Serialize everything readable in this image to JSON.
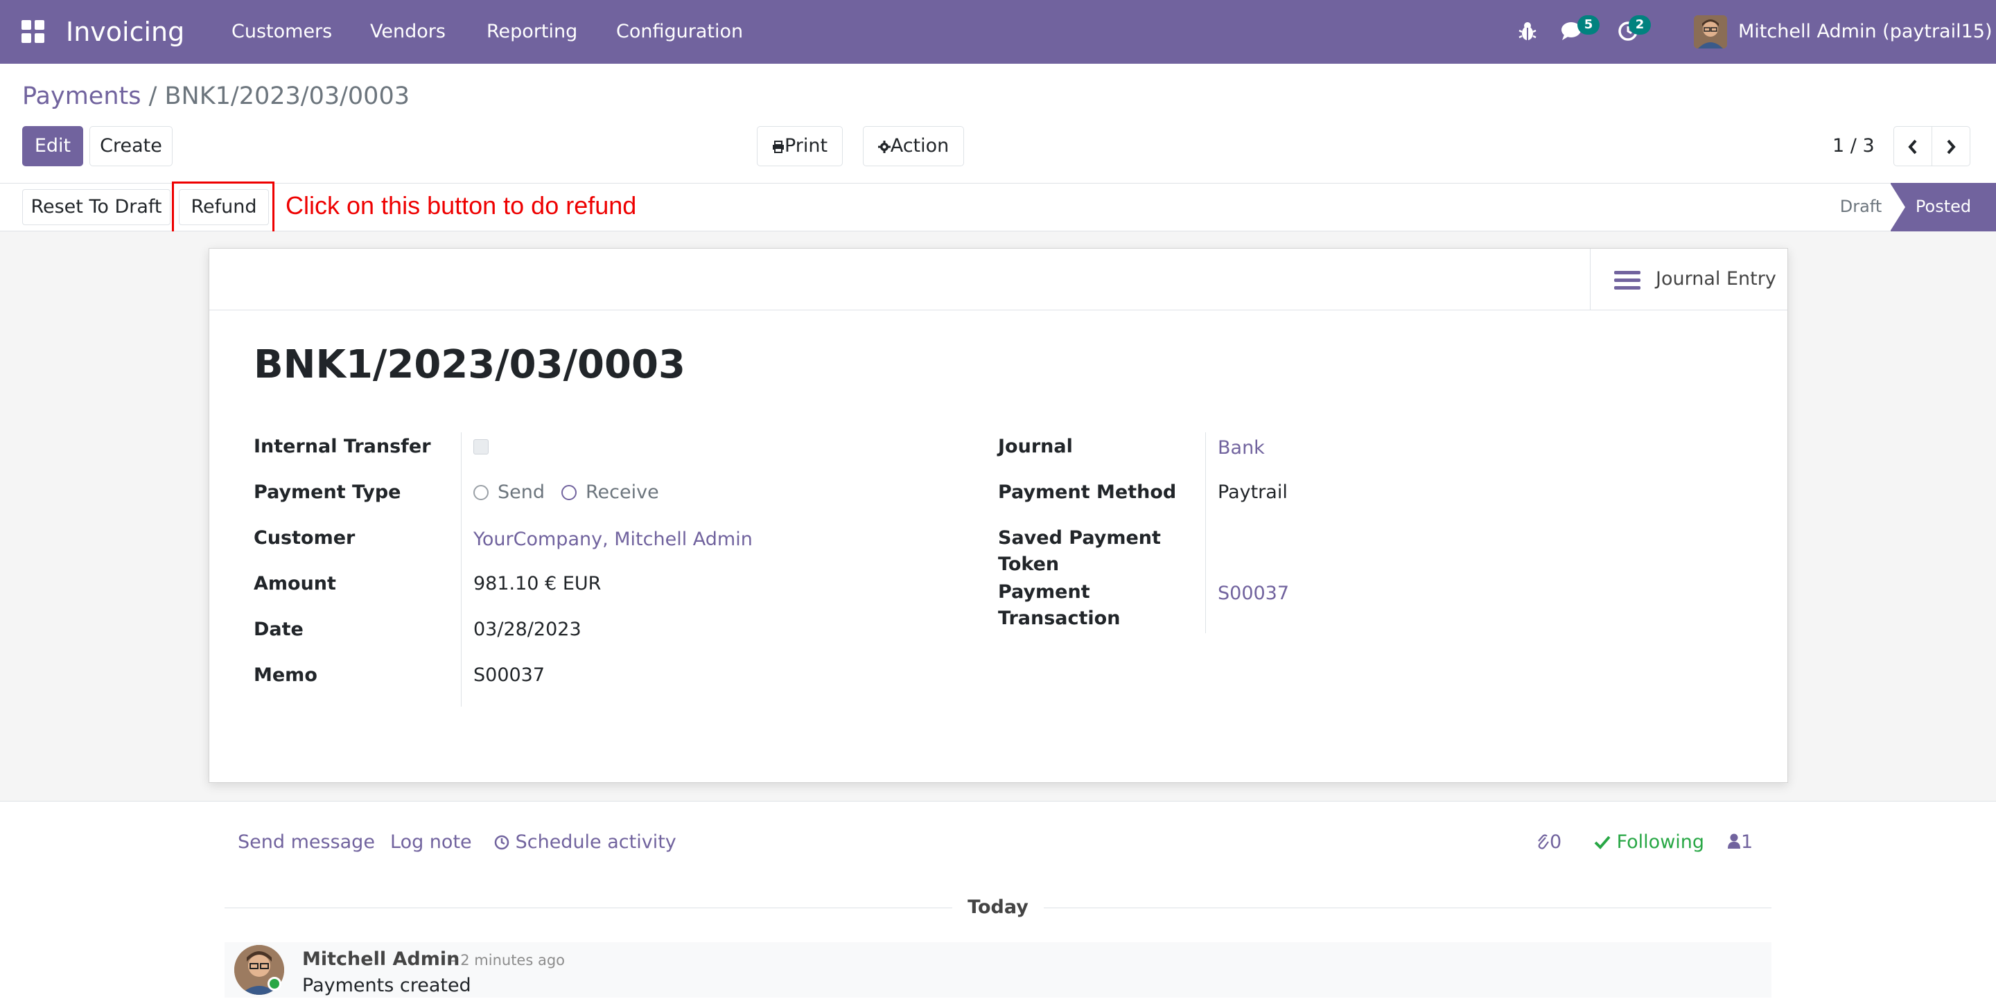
{
  "navbar": {
    "app_title": "Invoicing",
    "menu": [
      "Customers",
      "Vendors",
      "Reporting",
      "Configuration"
    ],
    "messages_badge": "5",
    "activities_badge": "2",
    "user_name": "Mitchell Admin (paytrail15)",
    "icons": [
      "apps-grid-icon",
      "bug-icon",
      "chat-icon",
      "clock-icon"
    ]
  },
  "breadcrumb": {
    "parent": "Payments",
    "separator": " / ",
    "current": "BNK1/2023/03/0003"
  },
  "control": {
    "edit_label": "Edit",
    "create_label": "Create",
    "print_label": "Print",
    "action_label": "Action",
    "pager": "1 / 3"
  },
  "statusbar": {
    "reset_label": "Reset To Draft",
    "refund_label": "Refund",
    "annotation": "Click on this button to do refund",
    "stages": [
      "Draft",
      "Posted"
    ],
    "active_stage": "Posted"
  },
  "form": {
    "smart_button": "Journal Entry",
    "title": "BNK1/2023/03/0003",
    "left": {
      "internal_transfer_label": "Internal Transfer",
      "internal_transfer_checked": false,
      "payment_type_label": "Payment Type",
      "payment_type_options": [
        "Send",
        "Receive"
      ],
      "customer_label": "Customer",
      "customer_value": "YourCompany, Mitchell Admin",
      "amount_label": "Amount",
      "amount_value": "981.10 € EUR",
      "date_label": "Date",
      "date_value": "03/28/2023",
      "memo_label": "Memo",
      "memo_value": "S00037"
    },
    "right": {
      "journal_label": "Journal",
      "journal_value": "Bank",
      "payment_method_label": "Payment Method",
      "payment_method_value": "Paytrail",
      "saved_token_label_1": "Saved Payment",
      "saved_token_label_2": "Token",
      "payment_transaction_label_1": "Payment",
      "payment_transaction_label_2": "Transaction",
      "payment_transaction_value": "S00037"
    }
  },
  "chatter": {
    "send_message": "Send message",
    "log_note": "Log note",
    "schedule_activity": "Schedule activity",
    "attachments_count": "0",
    "following_label": "Following",
    "followers_count": "1",
    "date_divider": "Today",
    "message": {
      "author": "Mitchell Admin",
      "time": "- 2 minutes ago",
      "body": "Payments created"
    }
  },
  "colors": {
    "brand": "#71639e",
    "badge": "#01827f",
    "annotation": "#ee0000",
    "following": "#28a745"
  }
}
